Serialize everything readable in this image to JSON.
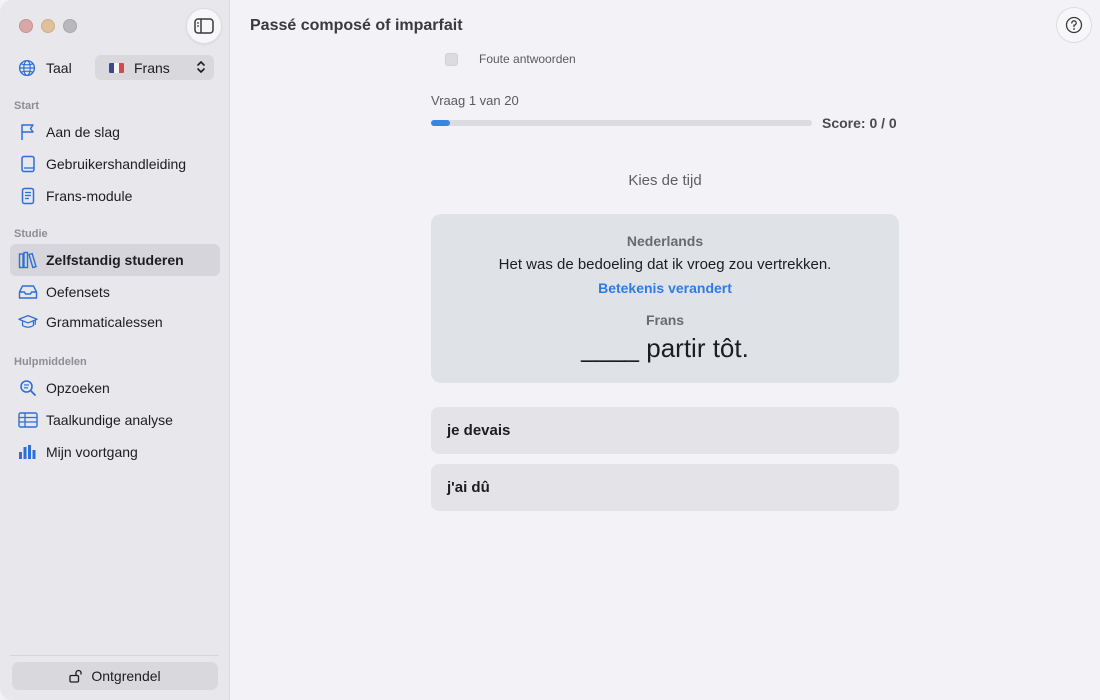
{
  "sidebar": {
    "language_label": "Taal",
    "language_value": "Frans",
    "sections": {
      "start": "Start",
      "study": "Studie",
      "tools": "Hulpmiddelen"
    },
    "items": [
      {
        "label": "Aan de slag",
        "icon": "flag-icon"
      },
      {
        "label": "Gebruikershandleiding",
        "icon": "book-icon"
      },
      {
        "label": "Frans-module",
        "icon": "document-icon"
      },
      {
        "label": "Zelfstandig studeren",
        "icon": "books-icon",
        "active": true
      },
      {
        "label": "Oefensets",
        "icon": "tray-icon"
      },
      {
        "label": "Grammaticalessen",
        "icon": "graduation-cap-icon"
      },
      {
        "label": "Opzoeken",
        "icon": "magnifier-icon"
      },
      {
        "label": "Taalkundige analyse",
        "icon": "table-icon"
      },
      {
        "label": "Mijn voortgang",
        "icon": "bar-chart-icon"
      }
    ],
    "unlock_label": "Ontgrendel"
  },
  "main": {
    "title": "Passé composé of imparfait",
    "wrong_answers_label": "Foute antwoorden",
    "question_label": "Vraag 1 van 20",
    "progress": 0.05,
    "score": "Score: 0 / 0",
    "prompt": "Kies de tijd",
    "card": {
      "source_language": "Nederlands",
      "source_text": "Het was de bedoeling dat ik vroeg zou vertrekken.",
      "note": "Betekenis verandert",
      "target_language": "Frans",
      "target_text": "____ partir tôt."
    },
    "answers": [
      "je devais",
      "j'ai dû"
    ]
  },
  "colors": {
    "accent": "#3a84e8",
    "sidebar_bg": "#e8e7ec",
    "card_bg": "#dfe3e8"
  }
}
